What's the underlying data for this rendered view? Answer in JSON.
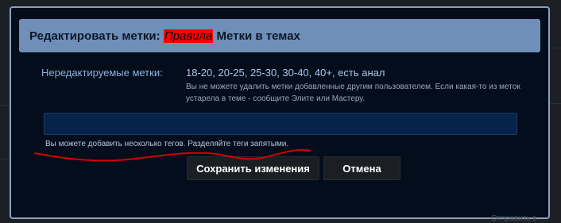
{
  "modal": {
    "title_prefix": "Редактировать метки:",
    "title_link": "Правила",
    "title_suffix": "Метки в темах"
  },
  "fixed_tags": {
    "label": "Нередактируемые метки:",
    "value": "18-20, 20-25, 25-30, 30-40, 40+, есть анал",
    "note": "Вы не можете удалить метки добавленные другим пользователем. Если какая-то из меток устарела в теме - сообщите Элите или Мастеру."
  },
  "tag_input": {
    "value": "",
    "hint": "Вы можете добавить несколько тегов. Разделяйте теги запятыми."
  },
  "buttons": {
    "save_label": "Сохранить изменения",
    "cancel_label": "Отмена"
  },
  "background_text": "Отправить в",
  "colors": {
    "header_bg": "#6f8fb8",
    "modal_bg": "#030d1c",
    "link_highlight": "#ff0000",
    "annotation_stroke": "#d40000"
  }
}
